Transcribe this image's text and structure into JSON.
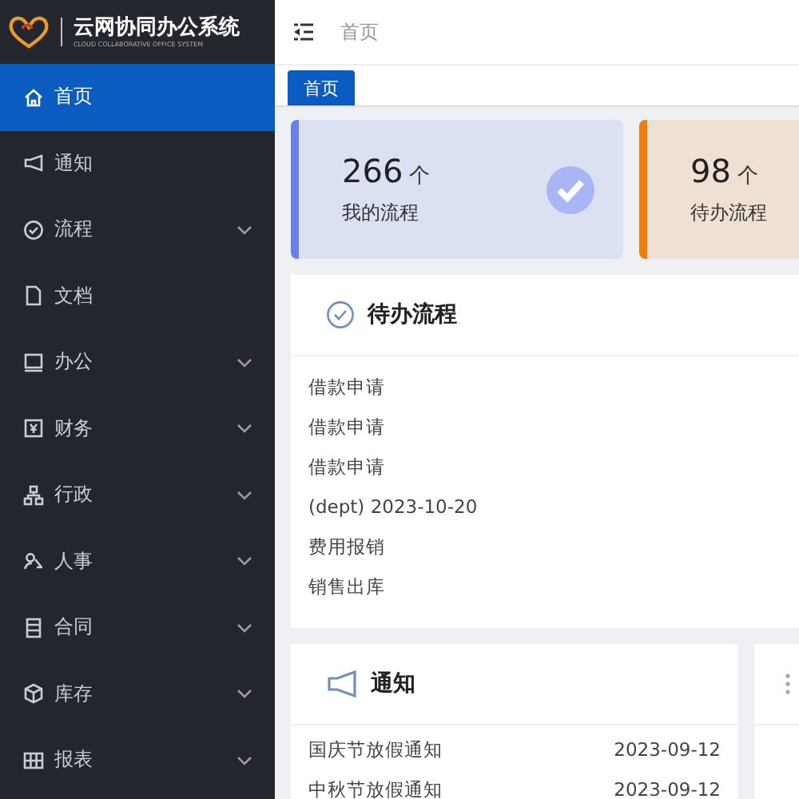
{
  "app": {
    "title": "云网协同办公系统",
    "subtitle": "CLOUD COLLABORATIVE OFFICE SYSTEM"
  },
  "sidebar": {
    "items": [
      {
        "label": "首页",
        "selected": true,
        "expandable": false
      },
      {
        "label": "通知",
        "selected": false,
        "expandable": false
      },
      {
        "label": "流程",
        "selected": false,
        "expandable": true
      },
      {
        "label": "文档",
        "selected": false,
        "expandable": false
      },
      {
        "label": "办公",
        "selected": false,
        "expandable": true
      },
      {
        "label": "财务",
        "selected": false,
        "expandable": true
      },
      {
        "label": "行政",
        "selected": false,
        "expandable": true
      },
      {
        "label": "人事",
        "selected": false,
        "expandable": true
      },
      {
        "label": "合同",
        "selected": false,
        "expandable": true
      },
      {
        "label": "库存",
        "selected": false,
        "expandable": true
      },
      {
        "label": "报表",
        "selected": false,
        "expandable": true
      }
    ]
  },
  "breadcrumb": "首页",
  "tabs": [
    {
      "label": "首页",
      "selected": true
    }
  ],
  "stats": [
    {
      "value": "266",
      "unit": "个",
      "label": "我的流程",
      "color": "#6a7ef0"
    },
    {
      "value": "98",
      "unit": "个",
      "label": "待办流程",
      "color": "#f07e0e"
    }
  ],
  "todo_panel": {
    "title": "待办流程",
    "items": [
      "借款申请",
      "借款申请",
      "借款申请",
      "(dept) 2023-10-20",
      "费用报销",
      "销售出库"
    ]
  },
  "notice_panel": {
    "title": "通知",
    "rows": [
      {
        "title": "国庆节放假通知",
        "date": "2023-09-12"
      },
      {
        "title": "中秋节放假通知",
        "date": "2023-09-12"
      }
    ]
  }
}
